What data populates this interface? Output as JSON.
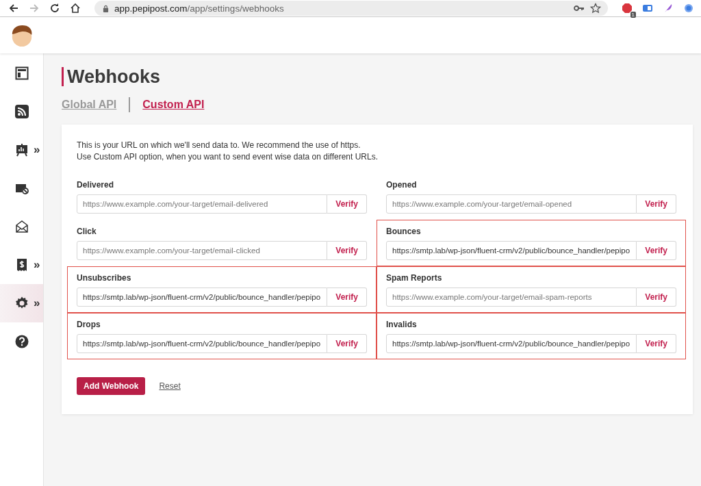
{
  "browser": {
    "back": {
      "disabled": false
    },
    "forward": {
      "disabled": true
    },
    "url_host": "app.pepipost.com",
    "url_path": "/app/settings/webhooks",
    "extension_badge": "1"
  },
  "sidebar": {
    "items": [
      {
        "kind": "dashboard",
        "selected": false
      },
      {
        "kind": "feed",
        "selected": false
      },
      {
        "kind": "reports",
        "selected": false,
        "chevron": "»"
      },
      {
        "kind": "mail-block",
        "selected": false
      },
      {
        "kind": "open-mail",
        "selected": false
      },
      {
        "kind": "billing",
        "selected": false,
        "chevron": "»"
      },
      {
        "kind": "settings",
        "selected": true,
        "chevron": "»"
      },
      {
        "kind": "help",
        "selected": false
      }
    ]
  },
  "page": {
    "title": "Webhooks",
    "tabs": [
      {
        "label": "Global API",
        "selected": false
      },
      {
        "label": "Custom API",
        "selected": true
      }
    ],
    "intro": [
      "This is your URL on which we'll send data to. We recommend the use of https.",
      "Use Custom API option, when you want to send event wise data on different URLs."
    ],
    "fields": [
      {
        "label": "Delivered",
        "placeholder": "https://www.example.com/your-target/email-delivered",
        "button": "Verify",
        "highlighted": false
      },
      {
        "label": "Opened",
        "placeholder": "https://www.example.com/your-target/email-opened",
        "button": "Verify",
        "highlighted": false
      },
      {
        "label": "Click",
        "placeholder": "https://www.example.com/your-target/email-clicked",
        "button": "Verify",
        "highlighted": false
      },
      {
        "label": "Bounces",
        "value": "https://smtp.lab/wp-json/fluent-crm/v2/public/bounce_handler/pepipo",
        "button": "Verify",
        "highlighted": true
      },
      {
        "label": "Unsubscribes",
        "value": "https://smtp.lab/wp-json/fluent-crm/v2/public/bounce_handler/pepipo",
        "button": "Verify",
        "highlighted": true
      },
      {
        "label": "Spam Reports",
        "placeholder": "https://www.example.com/your-target/email-spam-reports",
        "button": "Verify",
        "highlighted": true
      },
      {
        "label": "Drops",
        "value": "https://smtp.lab/wp-json/fluent-crm/v2/public/bounce_handler/pepipo",
        "button": "Verify",
        "highlighted": true
      },
      {
        "label": "Invalids",
        "value": "https://smtp.lab/wp-json/fluent-crm/v2/public/bounce_handler/pepipo",
        "button": "Verify",
        "highlighted": true
      }
    ],
    "primary_button": "Add Webhook",
    "reset_link": "Reset"
  }
}
